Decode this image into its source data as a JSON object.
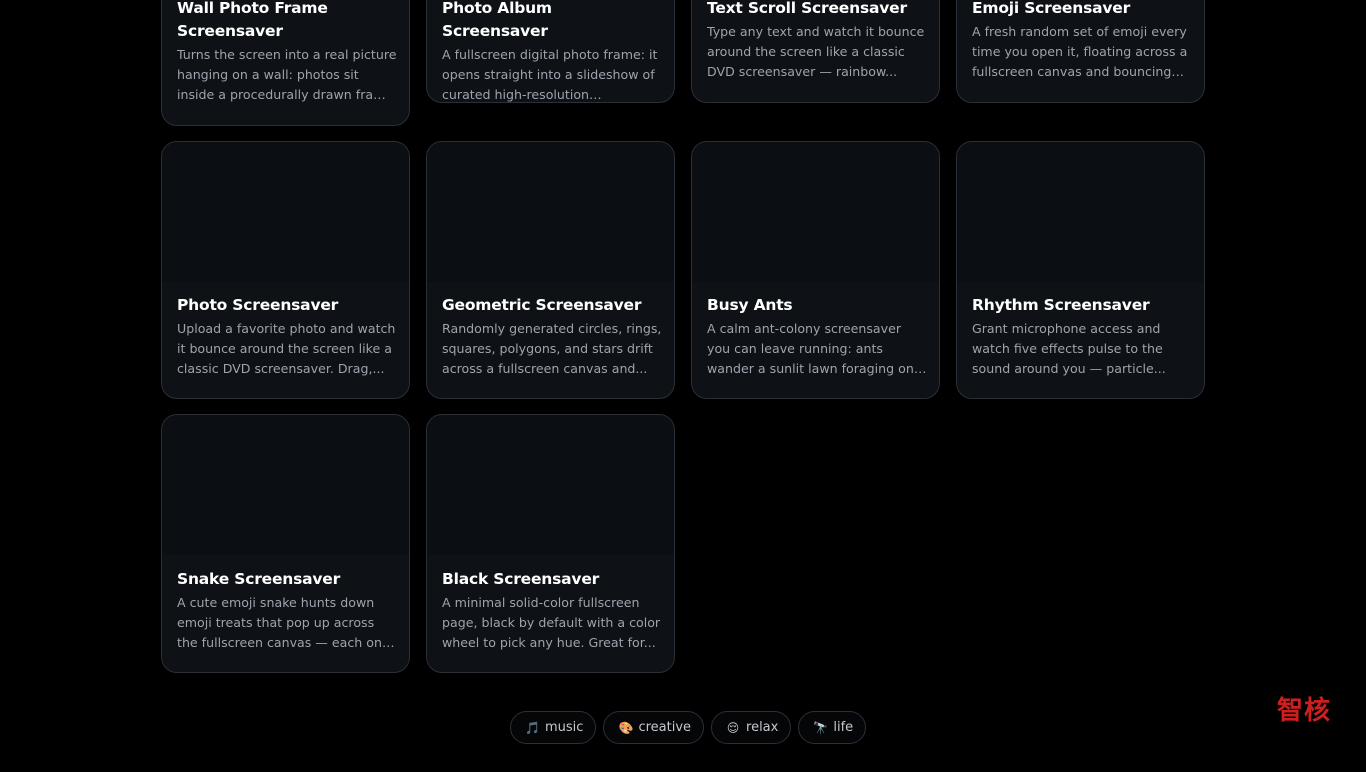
{
  "cards": [
    {
      "title": "Wall Photo Frame Screensaver",
      "desc": "Turns the screen into a real picture hanging on a wall: photos sit inside a procedurally drawn frame with..."
    },
    {
      "title": "Photo Album Screensaver",
      "desc": "A fullscreen digital photo frame: it opens straight into a slideshow of curated high-resolution landscape..."
    },
    {
      "title": "Text Scroll Screensaver",
      "desc": "Type any text and watch it bounce around the screen like a classic DVD screensaver — rainbow..."
    },
    {
      "title": "Emoji Screensaver",
      "desc": "A fresh random set of emoji every time you open it, floating across a fullscreen canvas and bouncing of..."
    },
    {
      "title": "Photo Screensaver",
      "desc": "Upload a favorite photo and watch it bounce around the screen like a classic DVD screensaver. Drag,..."
    },
    {
      "title": "Geometric Screensaver",
      "desc": "Randomly generated circles, rings, squares, polygons, and stars drift across a fullscreen canvas and..."
    },
    {
      "title": "Busy Ants",
      "desc": "A calm ant-colony screensaver you can leave running: ants wander a sunlit lawn foraging on their own..."
    },
    {
      "title": "Rhythm Screensaver",
      "desc": "Grant microphone access and watch five effects pulse to the sound around you — particle..."
    },
    {
      "title": "Snake Screensaver",
      "desc": "A cute emoji snake hunts down emoji treats that pop up across the fullscreen canvas — each one it..."
    },
    {
      "title": "Black Screensaver",
      "desc": "A minimal solid-color fullscreen page, black by default with a color wheel to pick any hue. Great for..."
    }
  ],
  "tags": [
    {
      "icon": "🎵",
      "icon_name": "music-note-icon",
      "label": "music"
    },
    {
      "icon": "🎨",
      "icon_name": "palette-icon",
      "label": "creative"
    },
    {
      "icon": "😌",
      "icon_name": "relieved-face-icon",
      "label": "relax"
    },
    {
      "icon": "🔭",
      "icon_name": "telescope-icon",
      "label": "life"
    }
  ],
  "watermark": "智核",
  "colors": {
    "background": "#000000",
    "card": "#0e1116",
    "card_border": "#2b2f36",
    "title": "#ffffff",
    "description": "#9ea3ad",
    "watermark": "#cc1f1f"
  }
}
